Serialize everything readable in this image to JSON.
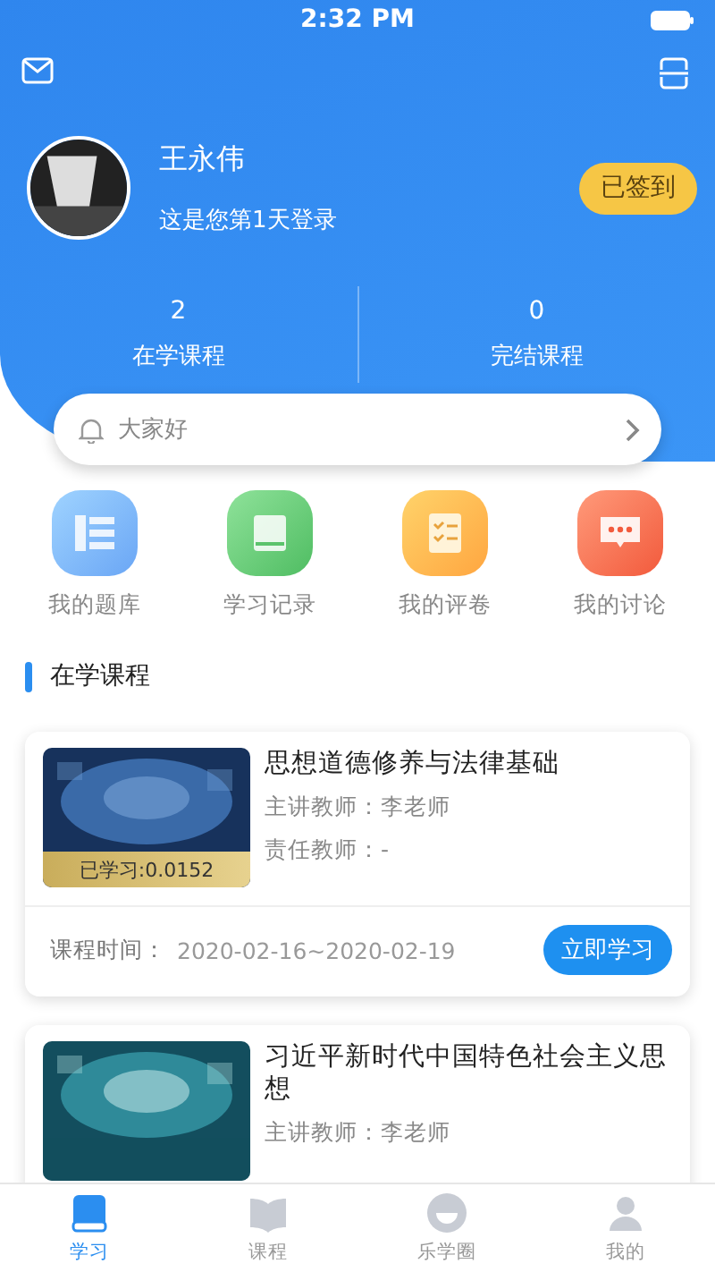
{
  "status_bar": {
    "time": "2:32 PM"
  },
  "profile": {
    "name": "王永伟",
    "subtitle": "这是您第1天登录",
    "checkin": "已签到"
  },
  "stats": [
    {
      "value": "2",
      "label": "在学课程"
    },
    {
      "value": "0",
      "label": "完结课程"
    }
  ],
  "notice": {
    "text": "大家好"
  },
  "shortcuts": [
    {
      "kind": "bank",
      "label": "我的题库"
    },
    {
      "kind": "record",
      "label": "学习记录"
    },
    {
      "kind": "grade",
      "label": "我的评卷"
    },
    {
      "kind": "discuss",
      "label": "我的讨论"
    }
  ],
  "section_title": "在学课程",
  "courses": [
    {
      "title": "思想道德修养与法律基础",
      "progress": "已学习:0.0152",
      "lines": [
        "主讲教师：李老师",
        "责任教师：-"
      ],
      "time_label": "课程时间：",
      "time": "2020-02-16~2020-02-19",
      "action": "立即学习"
    },
    {
      "title": "习近平新时代中国特色社会主义思想",
      "lines": [
        "主讲教师：李老师"
      ]
    }
  ],
  "tabs": [
    {
      "kind": "study",
      "label": "学习",
      "selected": true
    },
    {
      "kind": "course",
      "label": "课程",
      "selected": false
    },
    {
      "kind": "circle",
      "label": "乐学圈",
      "selected": false
    },
    {
      "kind": "me",
      "label": "我的",
      "selected": false
    }
  ]
}
